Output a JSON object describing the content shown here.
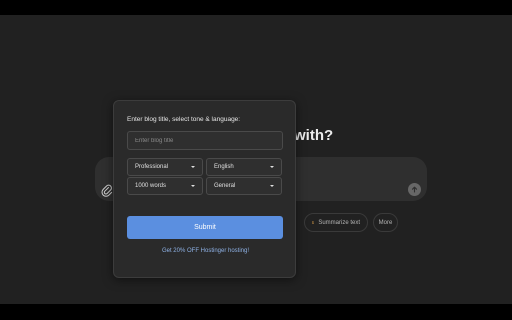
{
  "background": {
    "heading_fragment": "with?",
    "chips": [
      {
        "label": "Summarize text",
        "icon": "document-icon"
      },
      {
        "label": "More"
      }
    ],
    "icons": [
      "paperclip-icon",
      "arrow-up-icon"
    ]
  },
  "popup": {
    "title": "Enter blog title, select tone & language:",
    "title_placeholder": "Enter blog title",
    "tone": "Professional",
    "language": "English",
    "length": "1000 words",
    "style": "General",
    "submit_label": "Submit",
    "promo_link": "Get 20% OFF Hostinger hosting!"
  },
  "colors": {
    "page_bg": "#212121",
    "popup_bg": "#2a2a2a",
    "accent": "#5b8fe0",
    "link": "#8fb2e6"
  }
}
